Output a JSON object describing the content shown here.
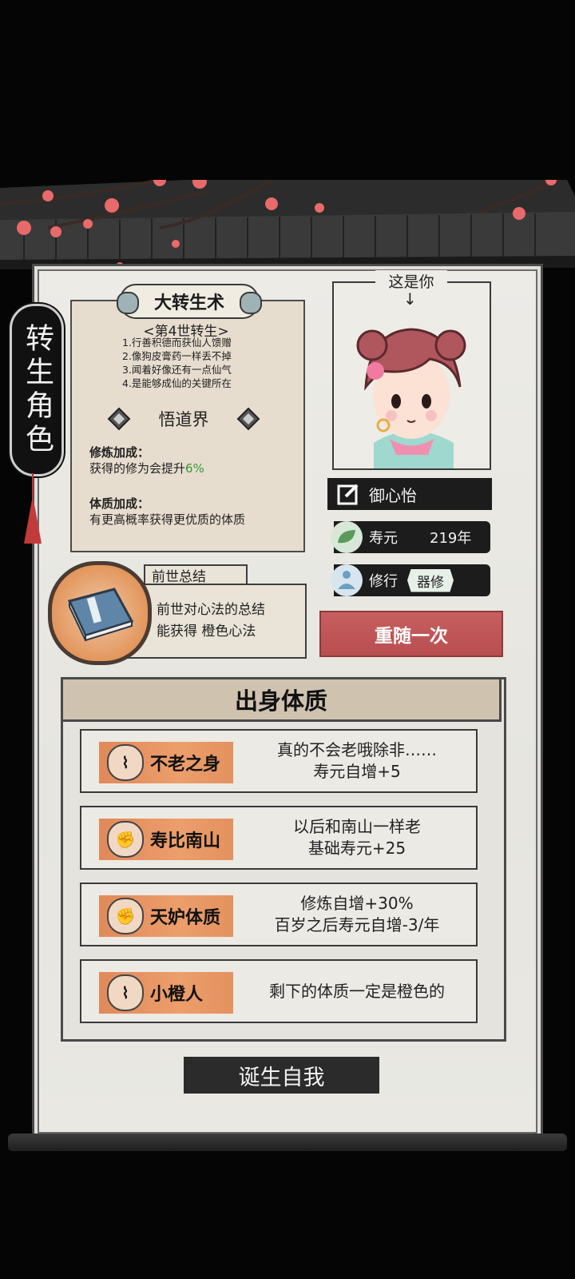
{
  "side_tag": {
    "label": "转生角色"
  },
  "rebirth": {
    "title": "大转生术",
    "generation": "<第4世转生>",
    "rules": [
      "1.行善积德而获仙人馈赠",
      "2.像狗皮膏药一样丢不掉",
      "3.闻着好像还有一点仙气",
      "4.是能够成仙的关键所在"
    ],
    "realm": "悟道界",
    "cultivation_bonus": {
      "label": "修炼加成：",
      "text": "获得的修为会提升",
      "value": "6%"
    },
    "constitution_bonus": {
      "label": "体质加成：",
      "text": "有更高概率获得更优质的体质"
    }
  },
  "summary": {
    "tab": "前世总结",
    "line1": "前世对心法的总结",
    "line2": "能获得 橙色心法"
  },
  "portrait": {
    "label": "这是你",
    "arrow": "↓"
  },
  "character": {
    "name": "御心怡",
    "lifespan_label": "寿元",
    "lifespan_value": "219年",
    "cultivation_label": "修行",
    "cultivation_type": "器修"
  },
  "reroll_button": "重随一次",
  "constitution": {
    "title": "出身体质",
    "items": [
      {
        "name": "不老之身",
        "icon": "scroll-icon",
        "line1": "真的不会老哦除非……",
        "line2": "寿元自增+5"
      },
      {
        "name": "寿比南山",
        "icon": "fist-icon",
        "line1": "以后和南山一样老",
        "line2": "基础寿元+25"
      },
      {
        "name": "天妒体质",
        "icon": "fist-icon",
        "line1": "修炼自增+30%",
        "line2": "百岁之后寿元自增-3/年"
      },
      {
        "name": "小橙人",
        "icon": "scroll-icon",
        "line1": "剩下的体质一定是橙色的",
        "line2": ""
      }
    ]
  },
  "born_button": "诞生自我"
}
